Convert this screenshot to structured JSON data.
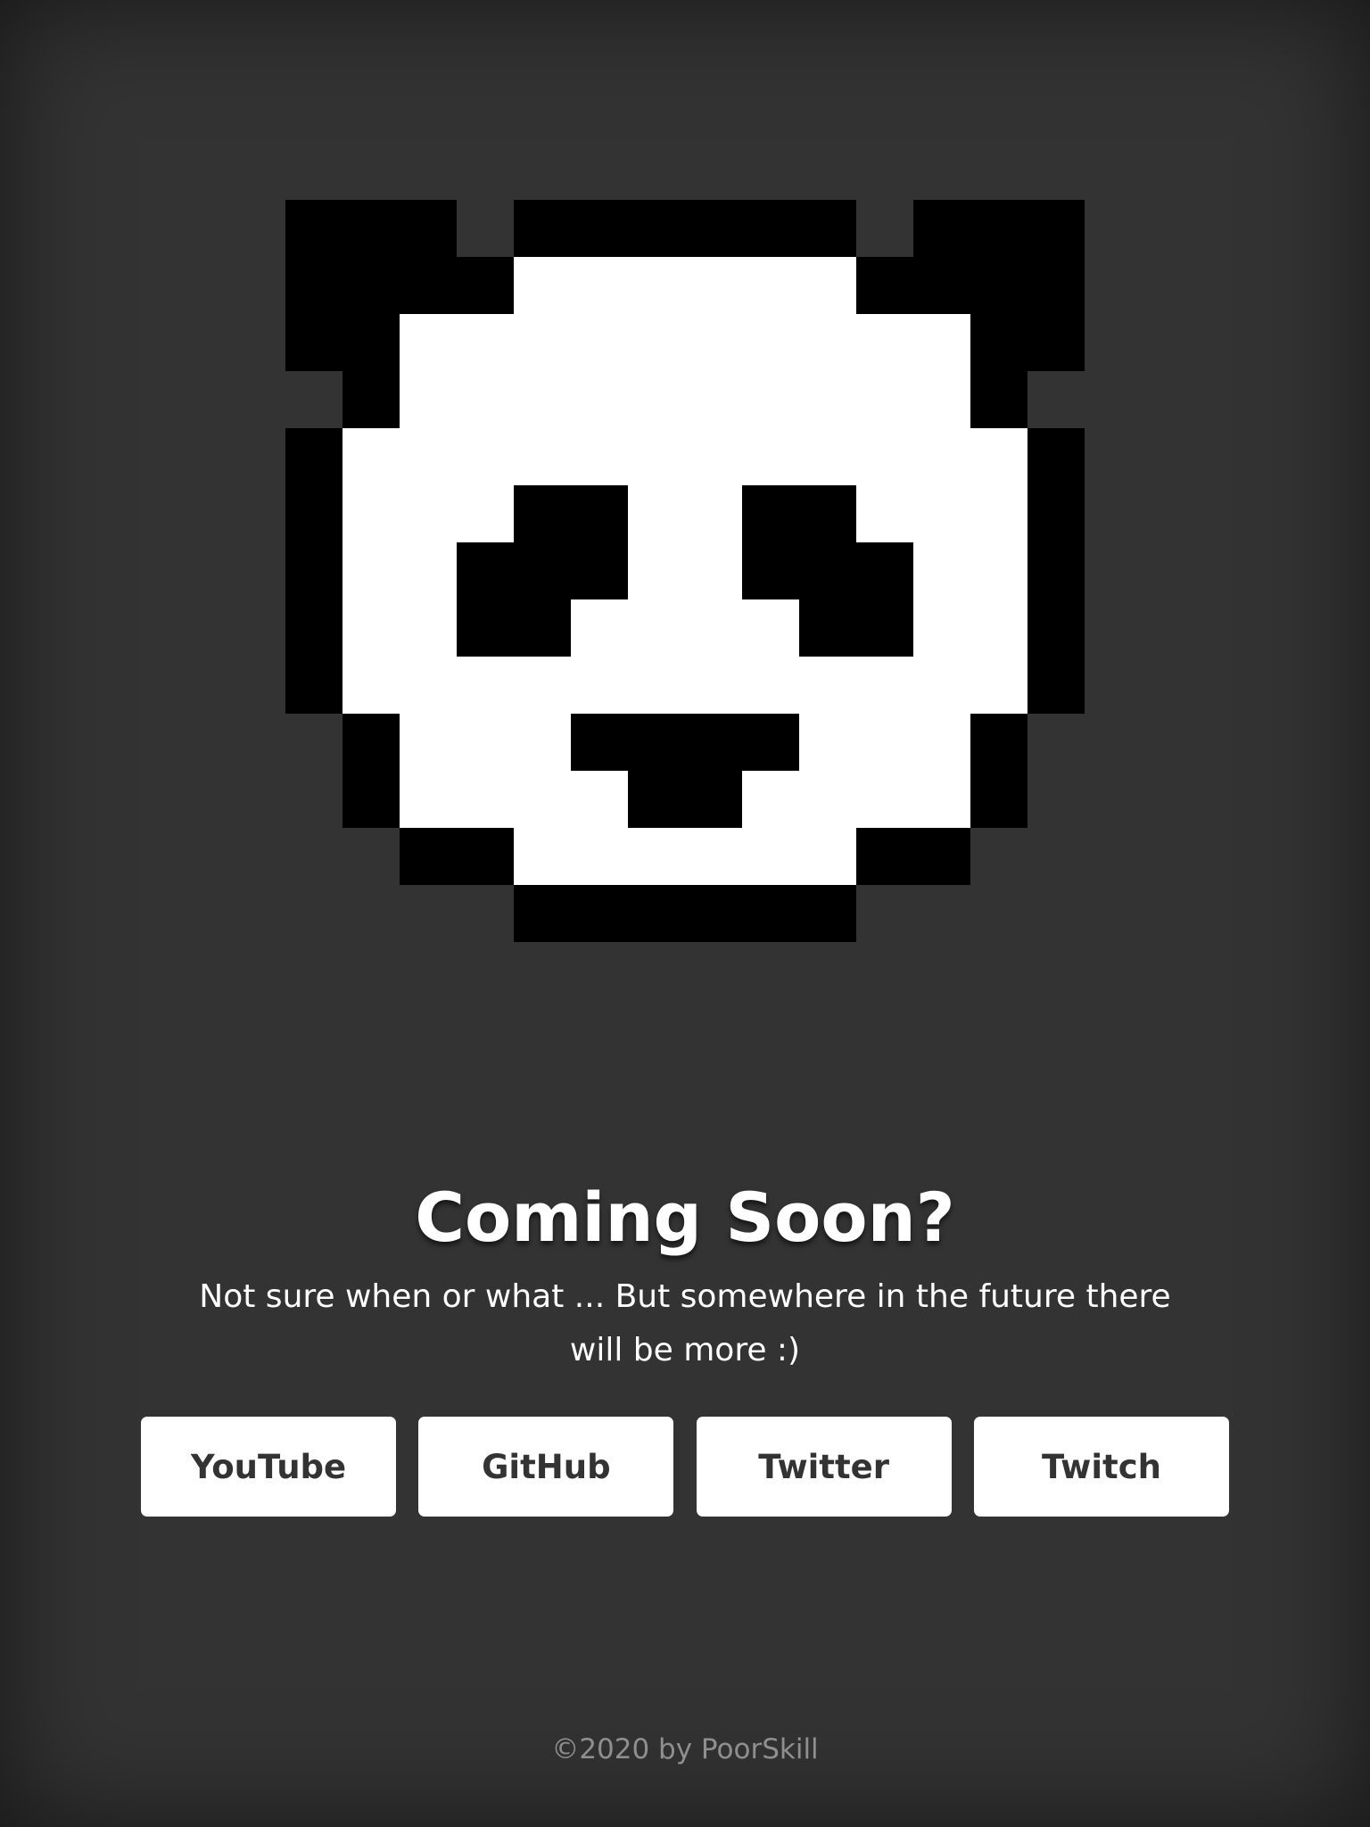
{
  "colors": {
    "background": "#333333",
    "panda_black": "#000000",
    "panda_white": "#ffffff",
    "button_bg": "#ffffff",
    "button_text": "#333333",
    "footer_text": "#8f8f8f"
  },
  "logo": {
    "icon": "pixel-panda-icon",
    "grid": [
      "111100111111001111",
      "111111000000111111",
      "111100000000001111",
      "011000000000000110",
      "100000000000000001",
      "100000110011000001",
      "100011100011100001",
      "100011000001100001",
      "100000000000000001",
      "100000000000000001",
      "001000001110000001",
      "001000000100000100",
      "000110000000011000",
      "000001111111000000"
    ]
  },
  "heading": "Coming Soon?",
  "subtitle": "Not sure when or what ... But somewhere in the future there will be more :)",
  "links": [
    {
      "label": "YouTube"
    },
    {
      "label": "GitHub"
    },
    {
      "label": "Twitter"
    },
    {
      "label": "Twitch"
    }
  ],
  "footer": "©2020 by PoorSkill"
}
